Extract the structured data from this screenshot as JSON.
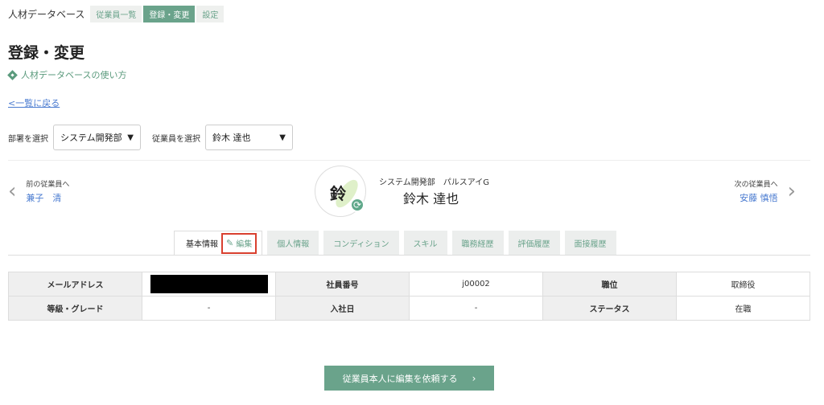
{
  "app_title": "人材データベース",
  "top_nav": [
    {
      "label": "従業員一覧"
    },
    {
      "label": "登録・変更"
    },
    {
      "label": "設定"
    }
  ],
  "page_title": "登録・変更",
  "help_link": "人材データベースの使い方",
  "back_link": "<一覧に戻る",
  "filters": {
    "dept_label": "部署を選択",
    "dept_value": "システム開発部",
    "emp_label": "従業員を選択",
    "emp_value": "鈴木 達也"
  },
  "prev_employee": {
    "caption": "前の従業員へ",
    "name": "兼子　清"
  },
  "next_employee": {
    "caption": "次の従業員へ",
    "name": "安藤 慎悟"
  },
  "profile": {
    "avatar_char": "鈴",
    "department": "システム開発部　パルスアイG",
    "name": "鈴木 達也"
  },
  "tabs": {
    "basic": "基本情報",
    "edit": "編集",
    "items": [
      "個人情報",
      "コンディション",
      "スキル",
      "職務経歴",
      "評価履歴",
      "面接履歴"
    ]
  },
  "info_table": {
    "mail_label": "メールアドレス",
    "employee_no_label": "社員番号",
    "employee_no": "j00002",
    "position_label": "職位",
    "position": "取締役",
    "grade_label": "等級・グレード",
    "grade": "-",
    "join_date_label": "入社日",
    "join_date": "-",
    "status_label": "ステータス",
    "status": "在職"
  },
  "cta_label": "従業員本人に編集を依頼する",
  "colors": {
    "accent": "#6aa38b",
    "link": "#4a7bd0",
    "highlight": "#d9402f"
  }
}
